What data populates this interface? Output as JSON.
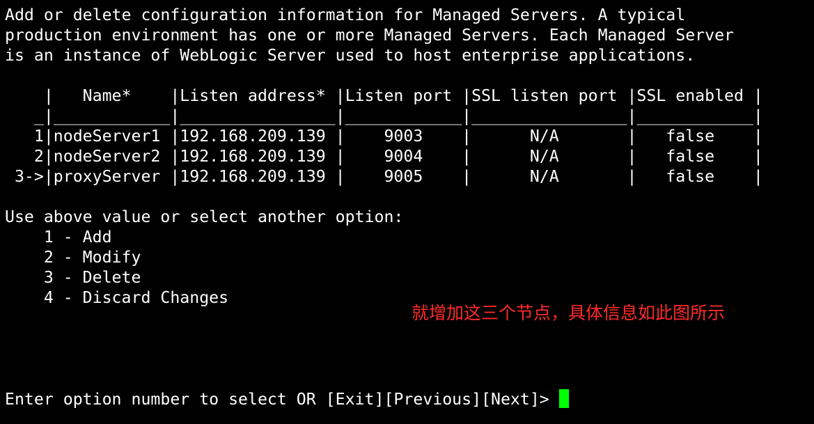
{
  "intro": {
    "lines": [
      "Add or delete configuration information for Managed Servers. A typical",
      "production environment has one or more Managed Servers. Each Managed Server",
      "is an instance of WebLogic Server used to host enterprise applications."
    ]
  },
  "table": {
    "header_line": "    |   Name*    |Listen address* |Listen port |SSL listen port |SSL enabled |",
    "separator_line": "   _|____________|________________|____________|________________|____________|",
    "rows": [
      "   1|nodeServer1 |192.168.209.139 |    9003    |      N/A       |   false    |",
      "   2|nodeServer2 |192.168.209.139 |    9004    |      N/A       |   false    |",
      " 3->|proxyServer |192.168.209.139 |    9005    |      N/A       |   false    |"
    ]
  },
  "options": {
    "heading": "Use above value or select another option:",
    "items": [
      "    1 - Add",
      "    2 - Modify",
      "    3 - Delete",
      "    4 - Discard Changes"
    ]
  },
  "annotation": {
    "text": "就增加这三个节点，具体信息如此图所示",
    "color": "#ff2a2a"
  },
  "prompt": {
    "text": "Enter option number to select OR [Exit][Previous][Next]> "
  },
  "cursor_color": "#00ff00"
}
